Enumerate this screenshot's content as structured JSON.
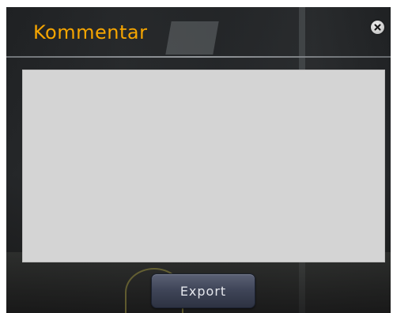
{
  "dialog": {
    "title": "Kommentar",
    "close_icon": "close-icon",
    "comment": {
      "value": ""
    },
    "export_label": "Export"
  },
  "colors": {
    "title": "#f6a500",
    "comment_background": "#d4d4d4",
    "button_background": "#404659"
  }
}
